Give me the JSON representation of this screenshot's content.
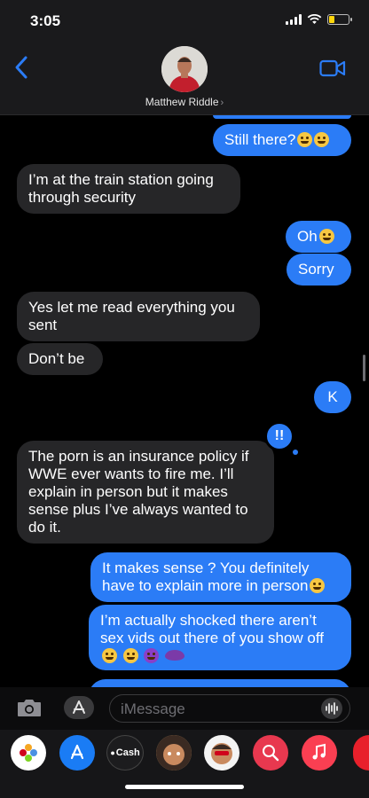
{
  "status_bar": {
    "time": "3:05"
  },
  "header": {
    "contact_name": "Matthew Riddle",
    "chevron": "›"
  },
  "messages": [
    {
      "side": "sent",
      "text": "Still there?"
    },
    {
      "side": "recv",
      "text": "I’m at the train station going through security"
    },
    {
      "side": "sent",
      "text": "Oh"
    },
    {
      "side": "sent",
      "text": "Sorry"
    },
    {
      "side": "recv",
      "text": "Yes let me read everything you sent"
    },
    {
      "side": "recv",
      "text": "Don’t be"
    },
    {
      "side": "sent",
      "text": "K"
    },
    {
      "side": "recv",
      "text": "The porn is an insurance policy if WWE ever wants to fire me. I’ll explain in person but it makes sense plus I’ve always wanted to do it."
    },
    {
      "side": "sent",
      "text": "It makes sense ? You definitely have to explain more in person"
    },
    {
      "side": "sent",
      "text": "I’m actually shocked there aren’t sex vids out there of you show off"
    }
  ],
  "reaction": {
    "icon": "emphasis-icon",
    "symbol": "!!"
  },
  "input": {
    "placeholder": "iMessage"
  },
  "app_drawer": {
    "cash_label": "Cash"
  },
  "colors": {
    "sent_bubble": "#2b7cf6",
    "recv_bubble": "#262628",
    "accent": "#2b7cf6"
  }
}
